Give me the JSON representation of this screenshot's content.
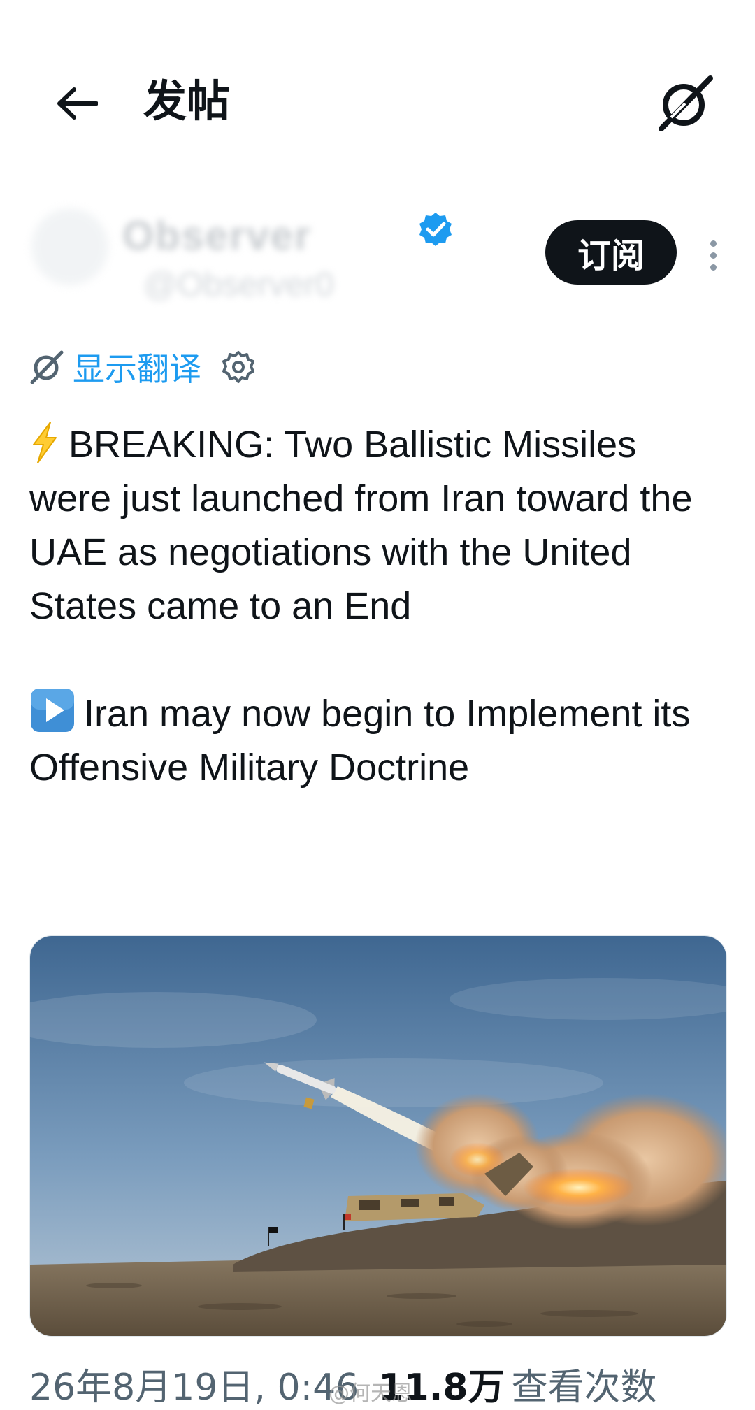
{
  "header": {
    "title": "发帖",
    "back_icon": "arrow-left-icon",
    "grok_icon": "grok-icon"
  },
  "author": {
    "display_name": "Observer",
    "handle": "@Observer0",
    "verified": true,
    "verified_color": "#1d9bf0",
    "subscribe_label": "订阅"
  },
  "translate": {
    "label": "显示翻译",
    "link_color": "#1d9bf0"
  },
  "post": {
    "paragraph1": "BREAKING: Two Ballistic Missiles were just launched from Iran toward the UAE as negotiations with the United States came to an End",
    "paragraph2": "Iran may now begin to Implement its Offensive Military Doctrine",
    "emoji1": "⚡",
    "emoji2": "▶️"
  },
  "meta": {
    "date": "26年8月19日, 0:46",
    "views_count": "11.8万",
    "views_label": "查看次数"
  },
  "watermark": "@何天恩"
}
